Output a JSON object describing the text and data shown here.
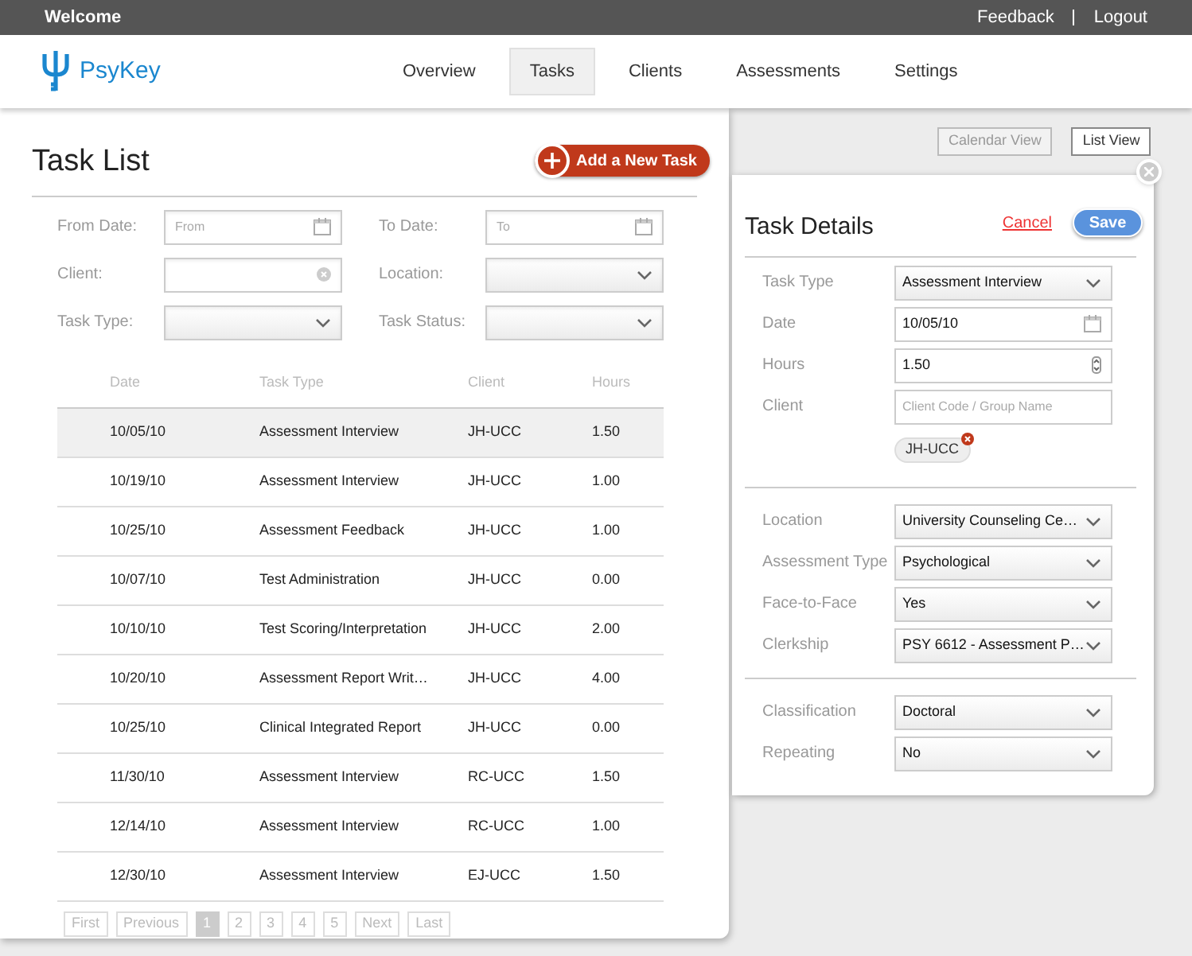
{
  "top_bar": {
    "title": "Welcome",
    "links": [
      "Feedback",
      "Logout"
    ]
  },
  "header": {
    "logo": "PsyKey",
    "nav": [
      {
        "label": "Overview",
        "selected": false
      },
      {
        "label": "Tasks",
        "selected": true
      },
      {
        "label": "Clients",
        "selected": false
      },
      {
        "label": "Assessments",
        "selected": false
      },
      {
        "label": "Settings",
        "selected": false
      }
    ]
  },
  "task_list": {
    "title": "Task List",
    "add_button": "Add a New Task",
    "filters": [
      {
        "label": "From Date:",
        "kind": "date",
        "placeholder": "From"
      },
      {
        "label": "To Date:",
        "kind": "date",
        "placeholder": "To"
      },
      {
        "label": "Client:",
        "kind": "clear"
      },
      {
        "label": "Location:",
        "kind": "select"
      },
      {
        "label": "Task Type:",
        "kind": "select"
      },
      {
        "label": "Task Status:",
        "kind": "select"
      }
    ],
    "columns": [
      "Date",
      "Task Type",
      "Client",
      "Hours"
    ],
    "rows": [
      {
        "cells": [
          "10/05/10",
          "Assessment Interview",
          "JH-UCC",
          "1.50"
        ],
        "selected": true
      },
      {
        "cells": [
          "10/19/10",
          "Assessment Interview",
          "JH-UCC",
          "1.00"
        ],
        "selected": false
      },
      {
        "cells": [
          "10/25/10",
          "Assessment Feedback",
          "JH-UCC",
          "1.00"
        ],
        "selected": false
      },
      {
        "cells": [
          "10/07/10",
          "Test Administration",
          "JH-UCC",
          "0.00"
        ],
        "selected": false
      },
      {
        "cells": [
          "10/10/10",
          "Test Scoring/Interpretation",
          "JH-UCC",
          "2.00"
        ],
        "selected": false
      },
      {
        "cells": [
          "10/20/10",
          "Assessment Report Writ…",
          "JH-UCC",
          "4.00"
        ],
        "selected": false
      },
      {
        "cells": [
          "10/25/10",
          "Clinical Integrated Report",
          "JH-UCC",
          "0.00"
        ],
        "selected": false
      },
      {
        "cells": [
          "11/30/10",
          "Assessment Interview",
          "RC-UCC",
          "1.50"
        ],
        "selected": false
      },
      {
        "cells": [
          "12/14/10",
          "Assessment Interview",
          "RC-UCC",
          "1.00"
        ],
        "selected": false
      },
      {
        "cells": [
          "12/30/10",
          "Assessment Interview",
          "EJ-UCC",
          "1.50"
        ],
        "selected": false
      }
    ],
    "pagination": [
      {
        "label": "First",
        "selected": false
      },
      {
        "label": "Previous",
        "selected": false
      },
      {
        "label": "1",
        "selected": true
      },
      {
        "label": "2",
        "selected": false
      },
      {
        "label": "3",
        "selected": false
      },
      {
        "label": "4",
        "selected": false
      },
      {
        "label": "5",
        "selected": false
      },
      {
        "label": "Next",
        "selected": false
      },
      {
        "label": "Last",
        "selected": false
      }
    ]
  },
  "view_toggle": [
    {
      "label": "Calendar View",
      "selected": false
    },
    {
      "label": "List View",
      "selected": true
    }
  ],
  "details": {
    "title": "Task Details",
    "cancel": "Cancel",
    "save": "Save",
    "sections": [
      [
        {
          "label": "Task Type",
          "kind": "select",
          "value": "Assessment Interview"
        },
        {
          "label": "Date",
          "kind": "date",
          "value": "10/05/10"
        },
        {
          "label": "Hours",
          "kind": "number",
          "value": "1.50"
        },
        {
          "label": "Client",
          "kind": "text",
          "placeholder": "Client Code / Group Name",
          "tag": "JH-UCC"
        }
      ],
      [
        {
          "label": "Location",
          "kind": "select",
          "value": "University Counseling Ce…"
        },
        {
          "label": "Assessment Type",
          "kind": "select",
          "value": "Psychological"
        },
        {
          "label": "Face-to-Face",
          "kind": "select",
          "value": "Yes"
        },
        {
          "label": "Clerkship",
          "kind": "select",
          "value": "PSY 6612 - Assessment P…"
        }
      ],
      [
        {
          "label": "Classification",
          "kind": "select",
          "value": "Doctoral"
        },
        {
          "label": "Repeating",
          "kind": "select",
          "value": "No"
        }
      ]
    ]
  }
}
